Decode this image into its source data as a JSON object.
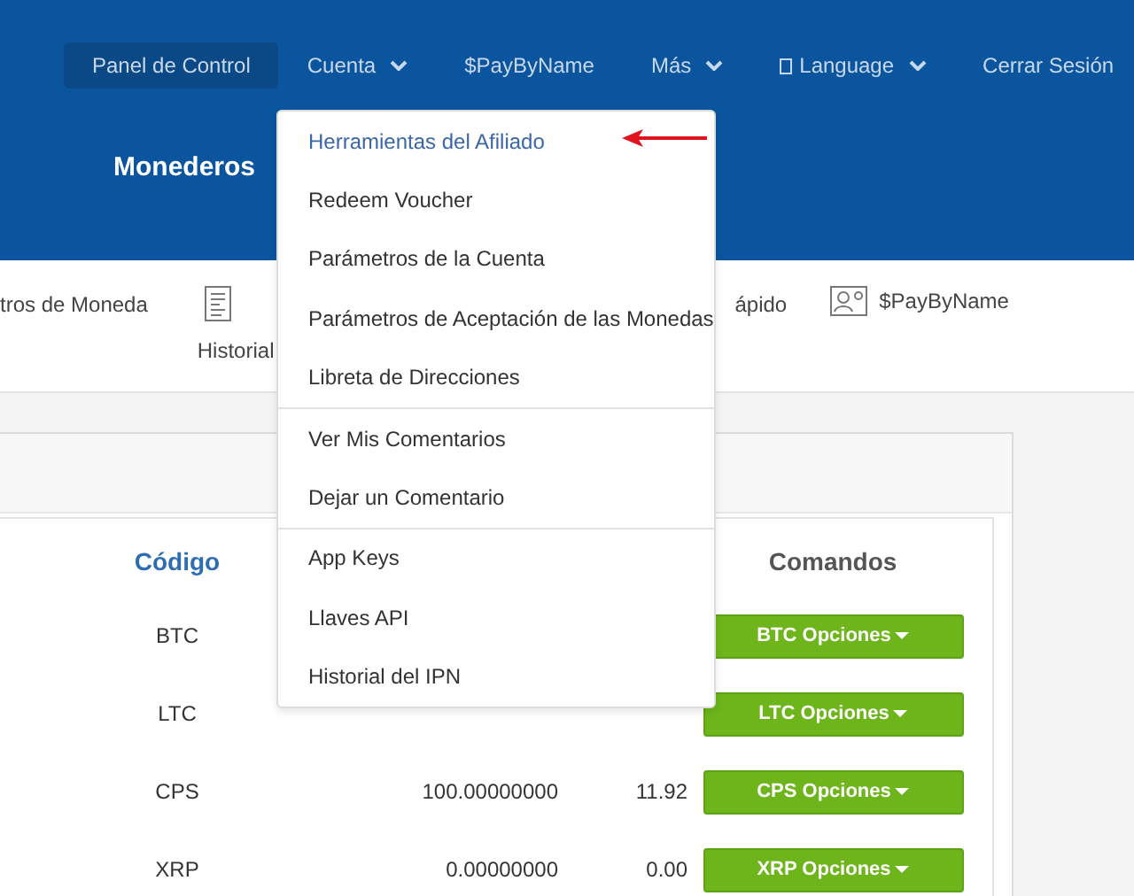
{
  "nav": [
    {
      "label": "Panel de Control",
      "selected": true,
      "caret": false
    },
    {
      "label": "Cuenta",
      "selected": false,
      "caret": true
    },
    {
      "label": "$PayByName",
      "selected": false,
      "caret": false
    },
    {
      "label": "Más",
      "selected": false,
      "caret": true
    },
    {
      "label": "Language",
      "selected": false,
      "caret": true,
      "glyph_box": true
    },
    {
      "label": "Cerrar Sesión",
      "selected": false,
      "caret": false
    }
  ],
  "page_title": "Monederos",
  "toolbar": [
    {
      "label": "tros de Moneda",
      "kind": "plain"
    },
    {
      "label": "Historial",
      "kind": "document"
    },
    {
      "label": "ápido",
      "kind": "plain"
    },
    {
      "label": "$PayByName",
      "kind": "contact"
    }
  ],
  "table": {
    "columns": [
      {
        "label": "Código",
        "kind": "link"
      },
      {
        "label": "Comandos",
        "kind": "plain"
      }
    ],
    "rows": [
      {
        "code": "BTC",
        "balance": "",
        "value": "",
        "button": "BTC Opciones"
      },
      {
        "code": "LTC",
        "balance": "",
        "value": "",
        "button": "LTC Opciones"
      },
      {
        "code": "CPS",
        "balance": "100.00000000",
        "value": "11.92",
        "button": "CPS Opciones"
      },
      {
        "code": "XRP",
        "balance": "0.00000000",
        "value": "0.00",
        "button": "XRP Opciones"
      }
    ]
  },
  "menu": {
    "groups": [
      [
        {
          "label": "Herramientas del Afiliado",
          "selected": true
        },
        {
          "label": "Redeem Voucher",
          "selected": false
        },
        {
          "label": "Parámetros de la Cuenta",
          "selected": false
        },
        {
          "label": "Parámetros de Aceptación de las Monedas",
          "selected": false
        },
        {
          "label": "Libreta de Direcciones",
          "selected": false
        }
      ],
      [
        {
          "label": "Ver Mis Comentarios",
          "selected": false
        },
        {
          "label": "Dejar un Comentario",
          "selected": false
        }
      ],
      [
        {
          "label": "App Keys",
          "selected": false
        },
        {
          "label": "Llaves API",
          "selected": false
        },
        {
          "label": "Historial del IPN",
          "selected": false
        }
      ]
    ]
  }
}
